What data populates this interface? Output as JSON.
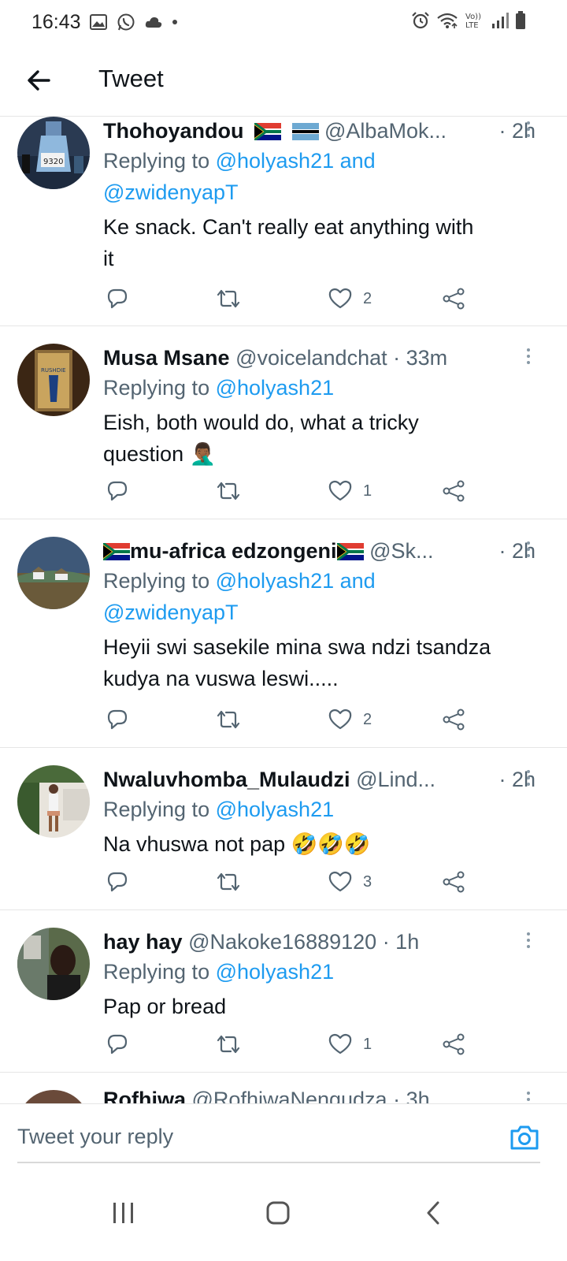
{
  "status_bar": {
    "time": "16:43",
    "left_icons": [
      "gallery-icon",
      "whatsapp-icon",
      "cloud-icon",
      "dot-icon"
    ],
    "right_icons": [
      "alarm-icon",
      "wifi-icon",
      "volte-icon",
      "signal-icon",
      "battery-icon"
    ],
    "volte_label": "Vo)) LTE"
  },
  "header": {
    "back_icon": "arrow-left-icon",
    "title": "Tweet"
  },
  "colors": {
    "accent": "#1d9bf0",
    "text": "#0f1419",
    "secondary": "#536471"
  },
  "tweets": [
    {
      "name": "Thohoyandou",
      "flags": [
        "south-africa-flag",
        "botswana-flag"
      ],
      "handle": "@AlbaMok...",
      "time": "· 2h",
      "replying_prefix": "Replying to ",
      "replying_to": "@holyash21 and",
      "replying_to_line2": "@zwidenyapT",
      "text_lines": [
        "Ke snack. Can't really eat anything with",
        "it"
      ],
      "likes": "2"
    },
    {
      "name": "Musa Msane",
      "handle": "@voicelandchat",
      "time": "· 33m",
      "replying_prefix": "Replying to ",
      "replying_to": "@holyash21",
      "text_lines": [
        "Eish, both would do, what a tricky",
        "question 🤦🏾‍♂️"
      ],
      "likes": "1"
    },
    {
      "name": "mu-africa edzongeni",
      "handle": "@Sk...",
      "time": "· 2h",
      "replying_prefix": "Replying to ",
      "replying_to": "@holyash21 and",
      "replying_to_line2": "@zwidenyapT",
      "text_lines": [
        "Heyii swi sasekile mina swa ndzi tsandza",
        "kudya na vuswa leswi....."
      ],
      "likes": "2"
    },
    {
      "name": "Nwaluvhomba_Mulaudzi",
      "handle": "@Lind...",
      "time": "· 2h",
      "replying_prefix": "Replying to ",
      "replying_to": "@holyash21",
      "text_lines": [
        "Na vhuswa not pap 🤣🤣🤣"
      ],
      "likes": "3"
    },
    {
      "name": "hay hay",
      "handle": "@Nakoke16889120",
      "time": "· 1h",
      "replying_prefix": "Replying to ",
      "replying_to": "@holyash21",
      "text_lines": [
        "Pap or bread"
      ],
      "likes": "1"
    },
    {
      "name": "Rofhiwa",
      "handle": "@RofhiwaNengudza",
      "time": "· 3h"
    }
  ],
  "reply_bar": {
    "placeholder": "Tweet your reply",
    "camera_icon": "camera-icon"
  },
  "nav_bar": {
    "icons": [
      "recent-apps-icon",
      "home-icon",
      "back-icon"
    ]
  }
}
